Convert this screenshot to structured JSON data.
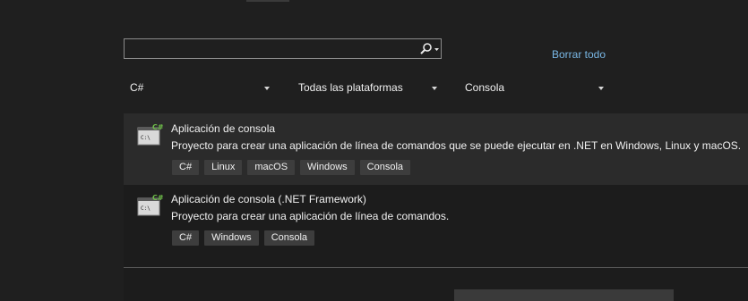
{
  "search": {
    "value": "",
    "placeholder": ""
  },
  "clear_all_label": "Borrar todo",
  "filters": {
    "language": "C#",
    "platform": "Todas las plataformas",
    "project_type": "Consola"
  },
  "templates": [
    {
      "title": "Aplicación de consola",
      "description": "Proyecto para crear una aplicación de línea de comandos que se puede ejecutar en .NET en Windows, Linux y macOS.",
      "tags": [
        "C#",
        "Linux",
        "macOS",
        "Windows",
        "Consola"
      ],
      "selected": true
    },
    {
      "title": "Aplicación de consola (.NET Framework)",
      "description": "Proyecto para crear una aplicación de línea de comandos.",
      "tags": [
        "C#",
        "Windows",
        "Consola"
      ],
      "selected": false
    }
  ],
  "icon_text": "C:\\",
  "colors": {
    "accent_link": "#79b8e6",
    "cs_badge": "#6fbf4a",
    "background": "#1f1f1f"
  }
}
